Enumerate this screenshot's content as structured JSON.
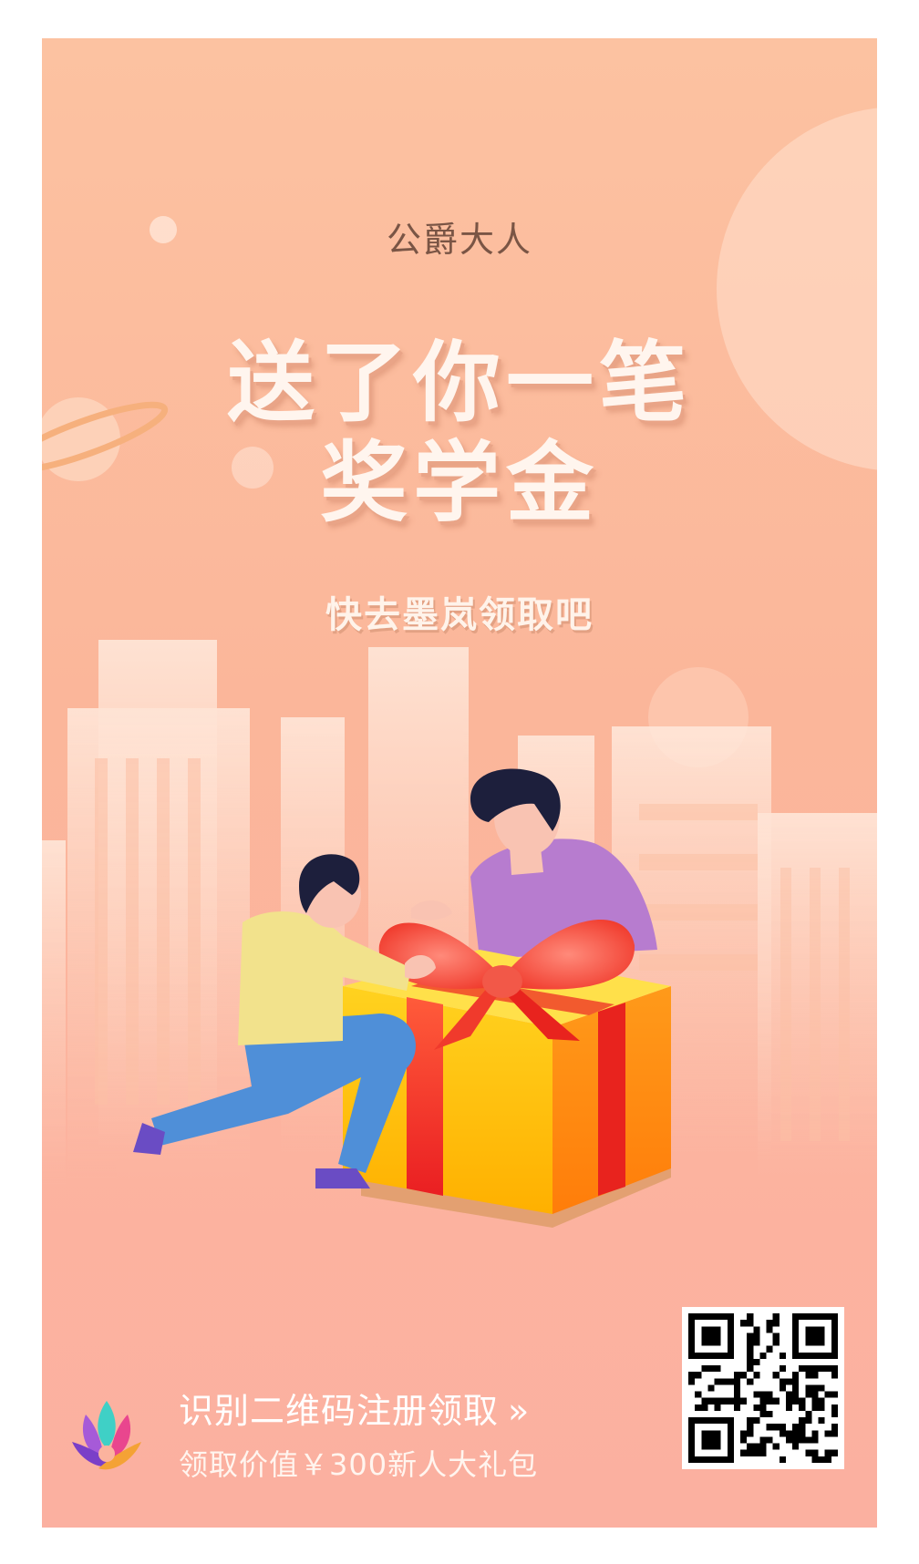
{
  "header": {
    "inviter": "公爵大人",
    "headline_line1": "送了你一笔",
    "headline_line2": "奖学金",
    "cta": "快去墨岚领取吧"
  },
  "footer": {
    "scan_text": "识别二维码注册领取",
    "arrow_icon": "double-chevron-right-icon",
    "gift_text": "领取价值￥300新人大礼包"
  },
  "colors": {
    "background_top": "#fcc2a1",
    "background_bottom": "#fbb0a0",
    "headline": "#fff5ee",
    "gift_ribbon": "#f0302a",
    "gift_box": "#ffc21a"
  },
  "icons": [
    "app-logo-icon",
    "planet-icon",
    "qr-code"
  ]
}
